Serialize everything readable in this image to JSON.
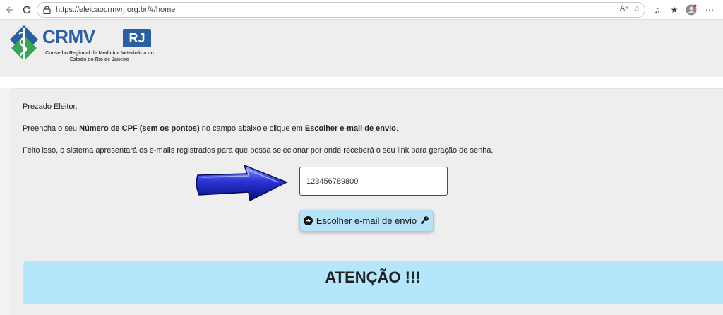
{
  "browser": {
    "url": "https://eleicaocrmvrj.org.br/#/home",
    "back_icon": "arrow-left",
    "reload_icon": "reload",
    "addr_icons": [
      "Aᵃ",
      "☆"
    ],
    "toolbar_icons": [
      "♫",
      "★",
      "☺",
      "⋯"
    ]
  },
  "logo": {
    "main": "CRMV",
    "badge": "RJ",
    "subtitle": "Conselho Regional de Medicina Veterinária do Estado do Rio de Janeiro"
  },
  "content": {
    "greeting": "Prezado Eleitor,",
    "instruction_prefix": "Preencha o seu ",
    "instruction_bold1": "Número de CPF (sem os pontos)",
    "instruction_mid": " no campo abaixo e clique em ",
    "instruction_bold2": "Escolher e-mail de envio",
    "instruction_suffix": ".",
    "info": "Feito isso, o sistema apresentará os e-mails registrados para que possa selecionar por onde receberá o seu link para geração de senha."
  },
  "form": {
    "cpf_value": "123456789800",
    "button_label": "Escolher e-mail de envio"
  },
  "attention": {
    "title": "ATENÇÃO !!!"
  },
  "colors": {
    "brand_blue": "#2b5fa0",
    "button_bg": "#b6e3f7",
    "attention_bg": "#b6e6fb"
  }
}
